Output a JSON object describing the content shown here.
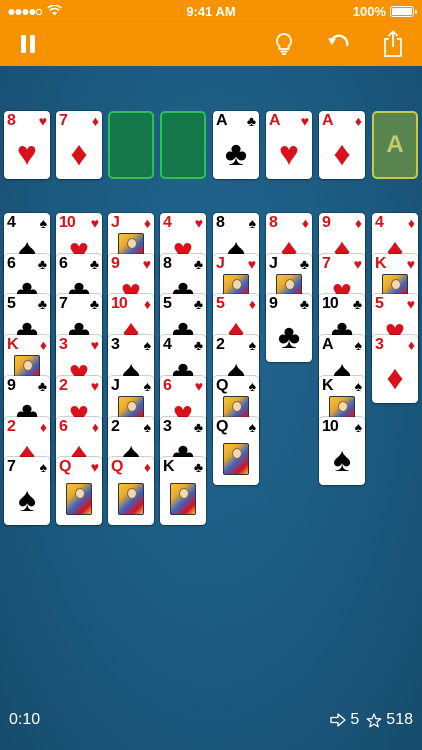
{
  "status_bar": {
    "time": "9:41 AM",
    "battery": "100%",
    "signal_icon": "signal-dots-icon",
    "wifi_icon": "wifi-icon"
  },
  "toolbar": {
    "pause_icon": "pause-icon",
    "hint_icon": "lightbulb-icon",
    "undo_icon": "undo-icon",
    "share_icon": "share-icon"
  },
  "colors": {
    "toolbar": "#f79300",
    "table": "#1c5a80",
    "red_suit": "#d9111b",
    "freecell_border": "#2fbf57",
    "freecell_fill": "#15784a",
    "foundation_slot_border": "#c8c84a"
  },
  "free_cells": [
    {
      "rank": "8",
      "suit": "♥",
      "color": "red"
    },
    {
      "rank": "7",
      "suit": "♦",
      "color": "red"
    },
    null,
    null
  ],
  "foundations": [
    {
      "rank": "A",
      "suit": "♣",
      "color": "black"
    },
    {
      "rank": "A",
      "suit": "♥",
      "color": "red"
    },
    {
      "rank": "A",
      "suit": "♦",
      "color": "red"
    },
    {
      "empty_label": "A"
    }
  ],
  "tableau": [
    [
      {
        "rank": "4",
        "suit": "♠",
        "color": "black"
      },
      {
        "rank": "6",
        "suit": "♣",
        "color": "black"
      },
      {
        "rank": "5",
        "suit": "♣",
        "color": "black"
      },
      {
        "rank": "K",
        "suit": "♦",
        "color": "red"
      },
      {
        "rank": "9",
        "suit": "♣",
        "color": "black"
      },
      {
        "rank": "2",
        "suit": "♦",
        "color": "red"
      },
      {
        "rank": "7",
        "suit": "♠",
        "color": "black"
      }
    ],
    [
      {
        "rank": "10",
        "suit": "♥",
        "color": "red"
      },
      {
        "rank": "6",
        "suit": "♣",
        "color": "black"
      },
      {
        "rank": "7",
        "suit": "♣",
        "color": "black"
      },
      {
        "rank": "3",
        "suit": "♥",
        "color": "red"
      },
      {
        "rank": "2",
        "suit": "♥",
        "color": "red"
      },
      {
        "rank": "6",
        "suit": "♦",
        "color": "red"
      },
      {
        "rank": "Q",
        "suit": "♥",
        "color": "red"
      }
    ],
    [
      {
        "rank": "J",
        "suit": "♦",
        "color": "red"
      },
      {
        "rank": "9",
        "suit": "♥",
        "color": "red"
      },
      {
        "rank": "10",
        "suit": "♦",
        "color": "red"
      },
      {
        "rank": "3",
        "suit": "♠",
        "color": "black"
      },
      {
        "rank": "J",
        "suit": "♠",
        "color": "black"
      },
      {
        "rank": "2",
        "suit": "♠",
        "color": "black"
      },
      {
        "rank": "Q",
        "suit": "♦",
        "color": "red"
      }
    ],
    [
      {
        "rank": "4",
        "suit": "♥",
        "color": "red"
      },
      {
        "rank": "8",
        "suit": "♣",
        "color": "black"
      },
      {
        "rank": "5",
        "suit": "♣",
        "color": "black"
      },
      {
        "rank": "4",
        "suit": "♣",
        "color": "black"
      },
      {
        "rank": "6",
        "suit": "♥",
        "color": "red"
      },
      {
        "rank": "3",
        "suit": "♣",
        "color": "black"
      },
      {
        "rank": "K",
        "suit": "♣",
        "color": "black"
      }
    ],
    [
      {
        "rank": "8",
        "suit": "♠",
        "color": "black"
      },
      {
        "rank": "J",
        "suit": "♥",
        "color": "red"
      },
      {
        "rank": "5",
        "suit": "♦",
        "color": "red"
      },
      {
        "rank": "2",
        "suit": "♠",
        "color": "black"
      },
      {
        "rank": "Q",
        "suit": "♠",
        "color": "black"
      },
      {
        "rank": "Q",
        "suit": "♠",
        "color": "black"
      }
    ],
    [
      {
        "rank": "8",
        "suit": "♦",
        "color": "red"
      },
      {
        "rank": "J",
        "suit": "♣",
        "color": "black"
      },
      {
        "rank": "9",
        "suit": "♣",
        "color": "black"
      }
    ],
    [
      {
        "rank": "9",
        "suit": "♦",
        "color": "red"
      },
      {
        "rank": "7",
        "suit": "♥",
        "color": "red"
      },
      {
        "rank": "10",
        "suit": "♣",
        "color": "black"
      },
      {
        "rank": "A",
        "suit": "♠",
        "color": "black"
      },
      {
        "rank": "K",
        "suit": "♠",
        "color": "black"
      },
      {
        "rank": "10",
        "suit": "♠",
        "color": "black"
      }
    ],
    [
      {
        "rank": "4",
        "suit": "♦",
        "color": "red"
      },
      {
        "rank": "K",
        "suit": "♥",
        "color": "red"
      },
      {
        "rank": "5",
        "suit": "♥",
        "color": "red"
      },
      {
        "rank": "3",
        "suit": "♦",
        "color": "red"
      }
    ]
  ],
  "footer": {
    "timer": "0:10",
    "moves": "5",
    "score": "518",
    "moves_icon": "arrow-right-icon",
    "score_icon": "star-icon"
  }
}
